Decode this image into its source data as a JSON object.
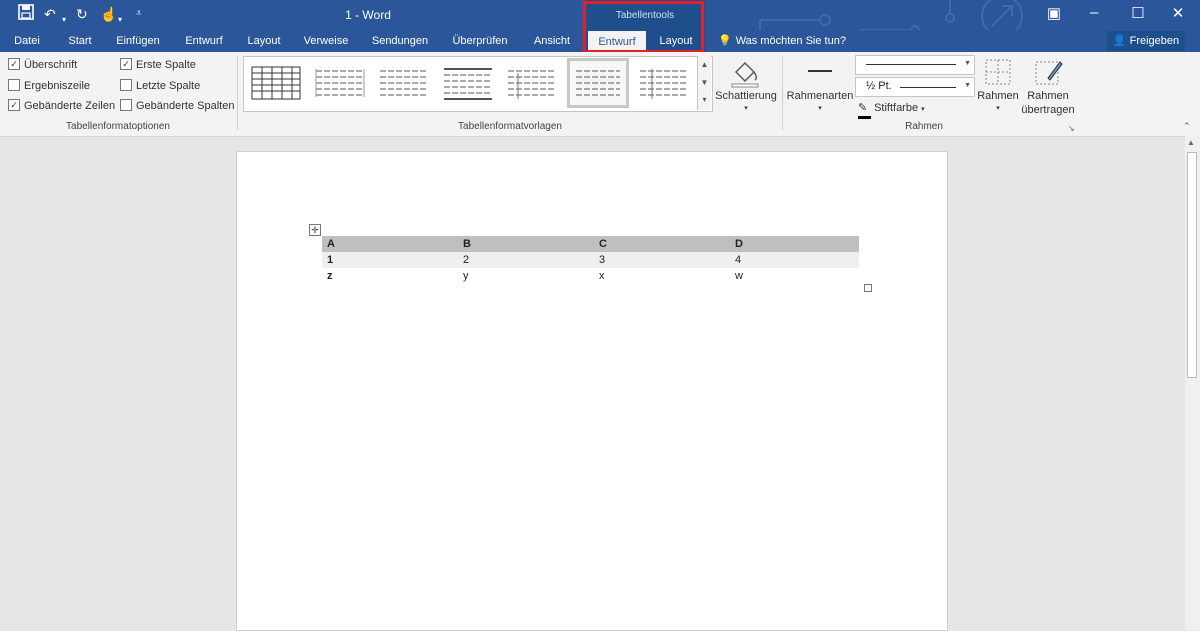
{
  "window": {
    "title": "1 - Word",
    "contextual_group": "Tabellentools"
  },
  "ribbon": {
    "tabs": [
      "Datei",
      "Start",
      "Einfügen",
      "Entwurf",
      "Layout",
      "Verweise",
      "Sendungen",
      "Überprüfen",
      "Ansicht"
    ],
    "contextual_tabs": [
      "Entwurf",
      "Layout"
    ],
    "active_tab": "Entwurf",
    "tell_me": "Was möchten Sie tun?",
    "share": "Freigeben"
  },
  "table_style_options": {
    "group_label": "Tabellenformatoptionen",
    "options": [
      {
        "label": "Überschrift",
        "checked": true
      },
      {
        "label": "Ergebniszeile",
        "checked": false
      },
      {
        "label": "Gebänderte Zeilen",
        "checked": true
      },
      {
        "label": "Erste Spalte",
        "checked": true
      },
      {
        "label": "Letzte Spalte",
        "checked": false
      },
      {
        "label": "Gebänderte Spalten",
        "checked": false
      }
    ]
  },
  "table_styles": {
    "group_label": "Tabellenformatvorlagen",
    "shading_label": "Schattierung"
  },
  "borders": {
    "group_label": "Rahmen",
    "border_styles_label": "Rahmenarten",
    "weight": "½ Pt.",
    "pen_color_label": "Stiftfarbe",
    "borders_label": "Rahmen",
    "painter_label_1": "Rahmen",
    "painter_label_2": "übertragen"
  },
  "document_table": {
    "rows": [
      [
        "A",
        "B",
        "C",
        "D"
      ],
      [
        "1",
        "2",
        "3",
        "4"
      ],
      [
        "z",
        "y",
        "x",
        "w"
      ]
    ]
  },
  "colors": {
    "title_bar": "#2b579a",
    "highlight_box": "#e0202a",
    "header_row": "#bfbfbf",
    "banded_row": "#efefef"
  }
}
